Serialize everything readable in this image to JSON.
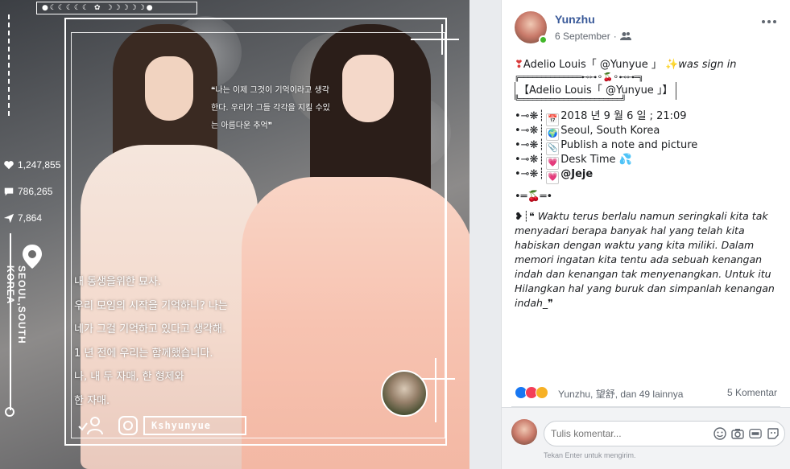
{
  "photo": {
    "moons_text": "●☾☾☾☾☾ ✿ ☽☽☽☽☽●",
    "stats": {
      "likes": "1,247,855",
      "comments": "786,265",
      "shares": "7,864"
    },
    "vertical_location": "SEOUL,SOUTH KOREA",
    "korean_quote": "❝나는 이제 그것이 기억이라고 생각한다. 우리가 그들 각각을 지킬 수있는 아름다운 추억❞",
    "korean_body": [
      "내 동생을위한 묘사.",
      "우리 모임의 시작을 기억하니? 나는",
      "네가 그걸 기억하고 있다고 생각해.",
      "1 년 전에 우리는 함께했습니다.",
      "나, 내 두 자매, 한 형제와",
      "한 자매."
    ],
    "brand": "Kshyunyue"
  },
  "post": {
    "author": "Yunzhu",
    "date": "6 September",
    "privacy_icon": "friends-icon",
    "headline_name": "Adelio Louis「 @Yunyue 」",
    "headline_suffix": "was sign in",
    "box_top": "╔══════════════⊷⊶⚬🍒⚬⊷⊶═╗",
    "box_text": "【Adelio Louis「 @Yunyue 」】",
    "box_bottom": "╚═══════════════════════╝",
    "lines": [
      {
        "icon": "calendar-icon",
        "text": "2018 년 9 월 6 일 ; 21:09"
      },
      {
        "icon": "globe-icon",
        "text": "Seoul, South Korea"
      },
      {
        "icon": "paperclip-icon",
        "text": "Publish a note and picture"
      },
      {
        "icon": "heart-icon",
        "text": "Desk Time 💦"
      },
      {
        "icon": "heart-icon",
        "text": "@Jeje"
      }
    ],
    "divider": "•═🍒═•",
    "paragraph": "❝ Waktu terus berlalu namun seringkali kita tak menyadari berapa banyak hal yang telah kita habiskan dengan waktu yang kita miliki. Dalam memori ingatan kita tentu ada sebuah kenangan indah dan kenangan tak menyenangkan. Untuk itu Hilangkan hal yang buruk dan simpanlah kenangan indah_❞",
    "reactors": "Yunzhu, 望舒, dan 49 lainnya",
    "comments_count": "5 Komentar",
    "comment_placeholder": "Tulis komentar...",
    "hint": "Tekan Enter untuk mengirim."
  },
  "colors": {
    "link": "#385898",
    "online": "#42b72a",
    "like": "#1877f2",
    "love": "#f33e58",
    "wow": "#f7b125"
  }
}
